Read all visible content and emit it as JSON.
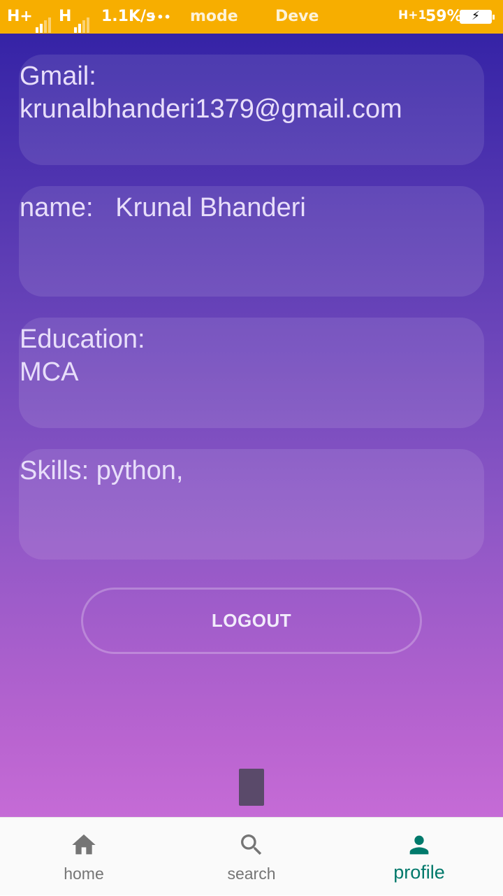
{
  "status_bar": {
    "net1": "H+",
    "net2": "H",
    "speed": "1.1K/s",
    "dots": "•••",
    "mode": "mode",
    "deve": "Deve",
    "net3": "H+1",
    "battery": "59%",
    "background_color": "#f7ae00"
  },
  "profile": {
    "gmail": "Gmail:\nkrunalbhanderi1379@gmail.com",
    "name": "name:   Krunal Bhanderi",
    "education": "Education:\nMCA",
    "skills": "Skills: python,"
  },
  "logout_label": "LOGOUT",
  "nav": {
    "items": [
      {
        "label": "home",
        "icon": "home-icon",
        "active": false
      },
      {
        "label": "search",
        "icon": "search-icon",
        "active": false
      },
      {
        "label": "profile",
        "icon": "person-icon",
        "active": true
      }
    ],
    "active_color": "#00796b",
    "inactive_color": "#757575"
  }
}
